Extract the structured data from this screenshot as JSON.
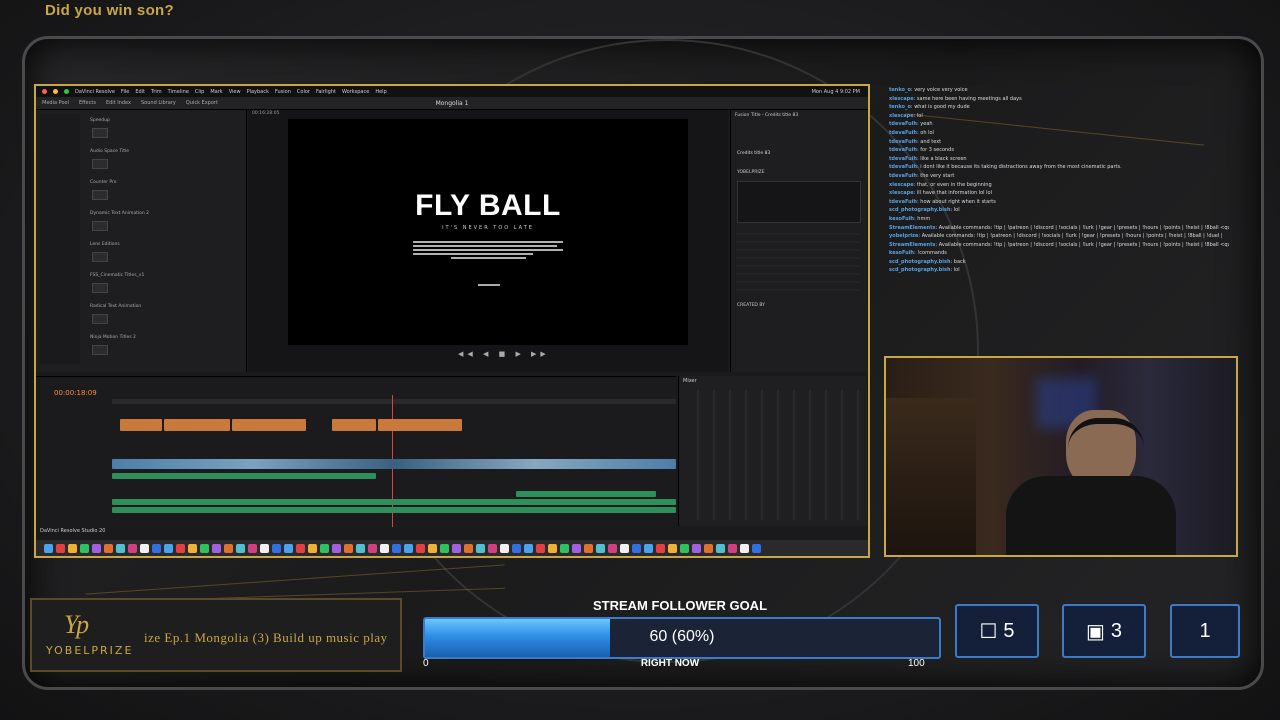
{
  "stream": {
    "top_title": "Did you win son?",
    "brand_name": "YOBELPRIZE",
    "ticker_text": "ize Ep.1 Mongolia (3) Build up music play"
  },
  "resolve": {
    "window_title": "Mongolia 1",
    "menu": [
      "DaVinci Resolve",
      "File",
      "Edit",
      "Trim",
      "Timeline",
      "Clip",
      "Mark",
      "View",
      "Playback",
      "Fusion",
      "Color",
      "Fairlight",
      "Workspace",
      "Help"
    ],
    "clock": "Mon Aug 4  9:02 PM",
    "toolbar": [
      "Media Pool",
      "Effects",
      "Edit Index",
      "Sound Library",
      "Quick Export"
    ],
    "timecode": "00:16:28:05",
    "current_timecode": "00:00:18:09",
    "viewer_title": "FLY BALL",
    "viewer_subtitle": "IT'S NEVER TOO LATE",
    "inspector_title": "Fusion Title - Credits title 83",
    "inspector_item": "Credits title 83",
    "inspector_label1": "YOBELPRIZE",
    "inspector_label2": "CREATED BY",
    "fx_items": [
      "Speedup",
      "Audio Space Title",
      "Counter Pro",
      "Dynamic Text Animation 2",
      "Lens Editions",
      "FSS_Cinematic Titles_v1",
      "Radical Text Animation",
      "Ninja Motion Titles 2"
    ],
    "dock_label": "DaVinci Resolve Studio 20",
    "mixer_label": "Mixer"
  },
  "chat": [
    {
      "user": "tenko_o",
      "msg": "very voice very voice"
    },
    {
      "user": "xlescape",
      "msg": "same here been having meetings all days"
    },
    {
      "user": "tenko_o",
      "msg": "what is good my dude"
    },
    {
      "user": "xlescape",
      "msg": "lol"
    },
    {
      "user": "tdevaFuih",
      "msg": "yeah"
    },
    {
      "user": "tdevaFuih",
      "msg": "oh lol"
    },
    {
      "user": "tdevaFuih",
      "msg": "and text"
    },
    {
      "user": "tdevaFuih",
      "msg": "for 3 seconds"
    },
    {
      "user": "tdevaFuih",
      "msg": "like a black screen"
    },
    {
      "user": "tdevaFuih",
      "msg": "i dont like it because its taking distractions away from the most cinematic parts."
    },
    {
      "user": "tdevaFuih",
      "msg": "the very start"
    },
    {
      "user": "xlescape",
      "msg": "that, or even in the beginning"
    },
    {
      "user": "xlescape",
      "msg": "ill have that information lol lol"
    },
    {
      "user": "tdevaFuih",
      "msg": "how about right when it starts"
    },
    {
      "user": "scd_photography.bish",
      "msg": "lol"
    },
    {
      "user": "kesoFuih",
      "msg": "hmm"
    },
    {
      "user": "StreamElements",
      "msg": "Available commands: !tip | !patreon | !discord | !socials | !lurk | !gear | !presets | !hours | !points | !heist | !8ball <question> | !duel <username> <points> |"
    },
    {
      "user": "yobelprize",
      "msg": "Available commands: !tip | !patreon | !discord | !socials | !lurk | !gear | !presets | !hours | !points | !heist | !8ball | !duel |"
    },
    {
      "user": "StreamElements",
      "msg": "Available commands: !tip | !patreon | !discord | !socials | !lurk | !gear | !presets | !hours | !points | !heist | !8ball <question> | !duel <username> <points> |"
    },
    {
      "user": "kesoFuih",
      "msg": "!commands"
    },
    {
      "user": "scd_photography.bish",
      "msg": "back"
    },
    {
      "user": "scd_photography.bish",
      "msg": "lol"
    }
  ],
  "goal": {
    "title": "STREAM FOLLOWER GOAL",
    "label": "60 (60%)",
    "fraction": 0.6,
    "min_label": "0",
    "max_label": "100",
    "caption": "RIGHT NOW"
  },
  "stats": [
    {
      "icon": "square-outline-icon",
      "value": "5"
    },
    {
      "icon": "film-icon",
      "value": "3"
    },
    {
      "icon": "",
      "value": "1"
    }
  ],
  "colors": {
    "gold": "#c9a646",
    "blue": "#3b7bc8",
    "chat_user": "#5aa0e0"
  }
}
